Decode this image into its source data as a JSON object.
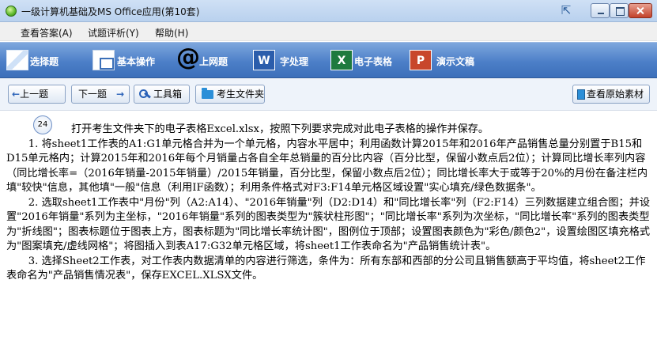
{
  "window": {
    "title": "一级计算机基础及MS Office应用(第10套)"
  },
  "menu": {
    "items": [
      "查看答案(A)",
      "试题评析(Y)",
      "帮助(H)"
    ]
  },
  "categories": [
    {
      "label": "选择题",
      "icon": "choice-icon"
    },
    {
      "label": "基本操作",
      "icon": "basic-ops-icon"
    },
    {
      "label": "上网题",
      "icon": "at-sign-icon"
    },
    {
      "label": "字处理",
      "icon": "word-icon",
      "icon_text": "W"
    },
    {
      "label": "电子表格",
      "icon": "excel-icon",
      "icon_text": "X"
    },
    {
      "label": "演示文稿",
      "icon": "powerpoint-icon",
      "icon_text": "P"
    }
  ],
  "toolbar": {
    "prev_label": "上一题",
    "prev_arrow": "←",
    "next_label": "下一题",
    "next_arrow": "→",
    "tools_label": "工具箱",
    "folder_label": "考生文件夹",
    "source_label": "查看原始素材"
  },
  "question": {
    "number": "24",
    "intro": "打开考生文件夹下的电子表格Excel.xlsx，按照下列要求完成对此电子表格的操作并保存。",
    "item1": "1. 将sheet1工作表的A1:G1单元格合并为一个单元格，内容水平居中；利用函数计算2015年和2016年产品销售总量分别置于B15和D15单元格内；计算2015年和2016年每个月销量占各自全年总销量的百分比内容（百分比型，保留小数点后2位）；计算同比增长率列内容（同比增长率=（2016年销量-2015年销量）/2015年销量，百分比型，保留小数点后2位）；同比增长率大于或等于20%的月份在备注栏内填\"较快\"信息，其他填\"一般\"信息（利用IF函数）；利用条件格式对F3:F14单元格区域设置\"实心填充/绿色数据条\"。",
    "item2": "2. 选取sheet1工作表中\"月份\"列（A2:A14）、\"2016年销量\"列（D2:D14）和\"同比增长率\"列（F2:F14）三列数据建立组合图；并设置\"2016年销量\"系列为主坐标，\"2016年销量\"系列的图表类型为\"簇状柱形图\"；\"同比增长率\"系列为次坐标，\"同比增长率\"系列的图表类型为\"折线图\"；图表标题位于图表上方，图表标题为\"同比增长率统计图\"，图例位于顶部；设置图表颜色为\"彩色/颜色2\"，设置绘图区填充格式为\"图案填充/虚线网格\"；将图插入到表A17:G32单元格区域，将sheet1工作表命名为\"产品销售统计表\"。",
    "item3": "3. 选择Sheet2工作表，对工作表内数据清单的内容进行筛选，条件为：所有东部和西部的分公司且销售额高于平均值，将sheet2工作表命名为\"产品销售情况表\"，保存EXCEL.XLSX文件。"
  }
}
